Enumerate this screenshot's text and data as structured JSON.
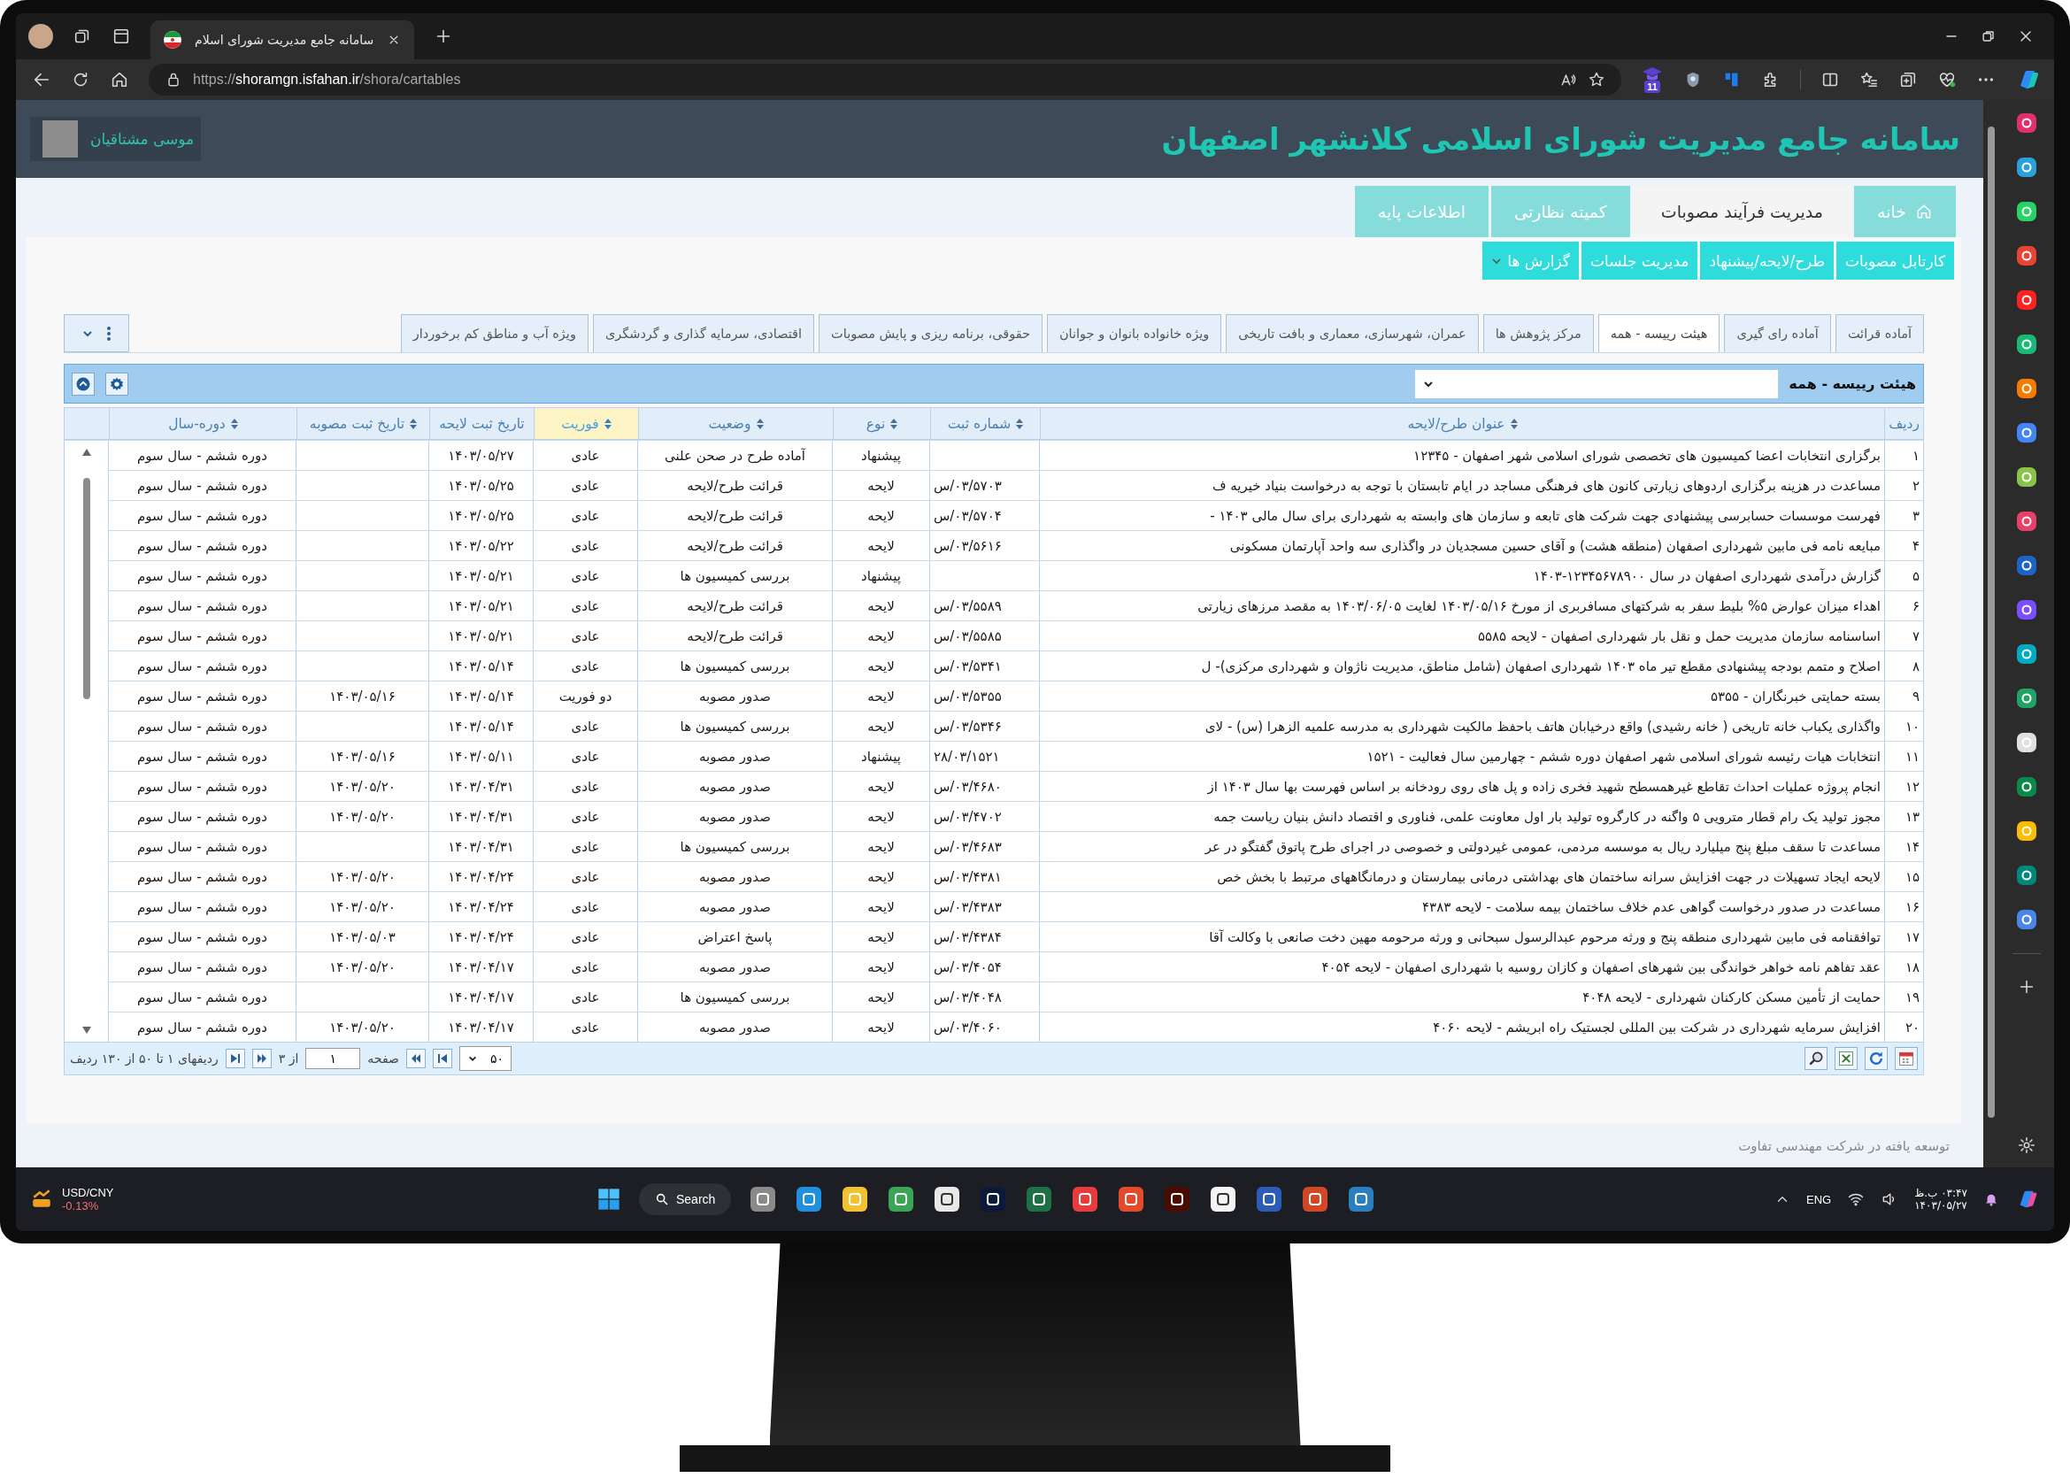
{
  "browser": {
    "tab_title": "سامانه جامع مدیریت شورای اسلام",
    "url": {
      "scheme": "https://",
      "host": "shoramgn.isfahan.ir",
      "path": "/shora/cartables"
    },
    "extension_badge": "11"
  },
  "header": {
    "title": "سامانه جامع مدیریت شورای اسلامی کلانشهر اصفهان",
    "user_name": "موسی مشتاقیان"
  },
  "main_nav": [
    {
      "label": "خانه",
      "kind": "home",
      "selected": false
    },
    {
      "label": "مدیریت فرآیند مصوبات",
      "kind": "plain",
      "selected": true
    },
    {
      "label": "کمیته نظارتی",
      "kind": "plain",
      "selected": false
    },
    {
      "label": "اطلاعات پایه",
      "kind": "plain",
      "selected": false
    }
  ],
  "sub_nav": [
    {
      "label": "کارتابل مصوبات",
      "has_menu": false
    },
    {
      "label": "طرح/لایحه/پیشنهاد",
      "has_menu": false
    },
    {
      "label": "مدیریت جلسات",
      "has_menu": false
    },
    {
      "label": "گزارش ها",
      "has_menu": true
    }
  ],
  "grid": {
    "category_tabs": [
      {
        "label": "آماده قرائت",
        "selected": false
      },
      {
        "label": "آماده رای گیری",
        "selected": false
      },
      {
        "label": "هیئت رییسه - همه",
        "selected": true
      },
      {
        "label": "مرکز پژوهش ها",
        "selected": false
      },
      {
        "label": "عمران، شهرسازی، معماری و بافت تاریخی",
        "selected": false
      },
      {
        "label": "ویژه خانواده بانوان و جوانان",
        "selected": false
      },
      {
        "label": "حقوقی، برنامه ریزی و پایش مصوبات",
        "selected": false
      },
      {
        "label": "اقتصادی، سرمایه گذاری و گردشگری",
        "selected": false
      },
      {
        "label": "ویژه آب و مناطق کم برخوردار",
        "selected": false
      }
    ],
    "filter_label": "هیئت رییسه - همه",
    "columns": [
      {
        "label": "ردیف",
        "sortable": false,
        "sorted": false
      },
      {
        "label": "عنوان طرح/لایحه",
        "sortable": true,
        "sorted": false
      },
      {
        "label": "شماره ثبت",
        "sortable": true,
        "sorted": false
      },
      {
        "label": "نوع",
        "sortable": true,
        "sorted": false
      },
      {
        "label": "وضعیت",
        "sortable": true,
        "sorted": false
      },
      {
        "label": "فوریت",
        "sortable": true,
        "sorted": true
      },
      {
        "label": "تاریخ ثبت لایحه",
        "sortable": false,
        "sorted": false
      },
      {
        "label": "تاریخ ثبت مصوبه",
        "sortable": true,
        "sorted": false
      },
      {
        "label": "دوره-سال",
        "sortable": true,
        "sorted": false
      }
    ],
    "rows": [
      [
        "۱",
        "برگزاری انتخابات اعضا کمیسیون های تخصصی شورای اسلامی شهر اصفهان - ۱۲۳۴۵",
        "",
        "پیشنهاد",
        "آماده طرح در صحن علنی",
        "عادی",
        "۱۴۰۳/۰۵/۲۷",
        "",
        "دوره ششم - سال سوم"
      ],
      [
        "۲",
        "مساعدت در هزینه برگزاری اردوهای زیارتی کانون های فرهنگی مساجد در ایام تابستان با توجه به درخواست بنیاد خیریه ف",
        "س/۰۳/۵۷۰۳",
        "لایحه",
        "قرائت طرح/لایحه",
        "عادی",
        "۱۴۰۳/۰۵/۲۵",
        "",
        "دوره ششم - سال سوم"
      ],
      [
        "۳",
        "فهرست موسسات حسابرسی پیشنهادی جهت شرکت های تابعه و سازمان های وابسته به شهرداری برای سال مالی ۱۴۰۳ -",
        "س/۰۳/۵۷۰۴",
        "لایحه",
        "قرائت طرح/لایحه",
        "عادی",
        "۱۴۰۳/۰۵/۲۵",
        "",
        "دوره ششم - سال سوم"
      ],
      [
        "۴",
        "مبایعه نامه فی مابین شهرداری اصفهان (منطقه هشت) و آقای حسین مسجدیان در واگذاری سه واحد آپارتمان مسکونی",
        "س/۰۳/۵۶۱۶",
        "لایحه",
        "قرائت طرح/لایحه",
        "عادی",
        "۱۴۰۳/۰۵/۲۲",
        "",
        "دوره ششم - سال سوم"
      ],
      [
        "۵",
        "گزارش درآمدی شهرداری اصفهان در سال ۱۲۳۴۵۶۷۸۹۰۰-۱۴۰۳",
        "",
        "پیشنهاد",
        "بررسی کمیسیون ها",
        "عادی",
        "۱۴۰۳/۰۵/۲۱",
        "",
        "دوره ششم - سال سوم"
      ],
      [
        "۶",
        "اهداء میزان عوارض ۵% بلیط سفر به شرکتهای مسافربری از مورخ ۱۴۰۳/۰۵/۱۶ لغایت ۱۴۰۳/۰۶/۰۵ به مقصد مرزهای زیارتی",
        "س/۰۳/۵۵۸۹",
        "لایحه",
        "قرائت طرح/لایحه",
        "عادی",
        "۱۴۰۳/۰۵/۲۱",
        "",
        "دوره ششم - سال سوم"
      ],
      [
        "۷",
        "اساسنامه سازمان مدیریت حمل و نقل بار شهرداری اصفهان - لایحه ۵۵۸۵",
        "س/۰۳/۵۵۸۵",
        "لایحه",
        "قرائت طرح/لایحه",
        "عادی",
        "۱۴۰۳/۰۵/۲۱",
        "",
        "دوره ششم - سال سوم"
      ],
      [
        "۸",
        "اصلاح و متمم بودجه پیشنهادی مقطع تیر ماه ۱۴۰۳ شهرداری اصفهان (شامل مناطق، مدیریت ناژوان و شهرداری مرکزی)- ل",
        "س/۰۳/۵۳۴۱",
        "لایحه",
        "بررسی کمیسیون ها",
        "عادی",
        "۱۴۰۳/۰۵/۱۴",
        "",
        "دوره ششم - سال سوم"
      ],
      [
        "۹",
        "بسته حمایتی خبرنگاران - ۵۳۵۵",
        "س/۰۳/۵۳۵۵",
        "لایحه",
        "صدور مصوبه",
        "دو فوریت",
        "۱۴۰۳/۰۵/۱۴",
        "۱۴۰۳/۰۵/۱۶",
        "دوره ششم - سال سوم"
      ],
      [
        "۱۰",
        "واگذاری یکباب خانه تاریخی ( خانه رشیدی) واقع درخیابان هاتف باحفظ مالکیت شهرداری به مدرسه علمیه الزهرا (س) - لای",
        "س/۰۳/۵۳۴۶",
        "لایحه",
        "بررسی کمیسیون ها",
        "عادی",
        "۱۴۰۳/۰۵/۱۴",
        "",
        "دوره ششم - سال سوم"
      ],
      [
        "۱۱",
        "انتخابات هیات رئیسه شورای اسلامی شهر اصفهان دوره ششم - چهارمین سال فعالیت - ۱۵۲۱",
        "۲۸/۰۳/۱۵۲۱",
        "پیشنهاد",
        "صدور مصوبه",
        "عادی",
        "۱۴۰۳/۰۵/۱۱",
        "۱۴۰۳/۰۵/۱۶",
        "دوره ششم - سال سوم"
      ],
      [
        "۱۲",
        "انجام پروژه عملیات احداث تقاطع غیرهمسطح شهید فخری زاده و پل های روی رودخانه بر اساس فهرست بها سال ۱۴۰۳ از",
        "س/۰۳/۴۶۸۰",
        "لایحه",
        "صدور مصوبه",
        "عادی",
        "۱۴۰۳/۰۴/۳۱",
        "۱۴۰۳/۰۵/۲۰",
        "دوره ششم - سال سوم"
      ],
      [
        "۱۳",
        "مجوز تولید یک رام قطار مترویی ۵ واگنه در کارگروه تولید بار اول معاونت علمی، فناوری و اقتصاد دانش بنیان ریاست جمه",
        "س/۰۳/۴۷۰۲",
        "لایحه",
        "صدور مصوبه",
        "عادی",
        "۱۴۰۳/۰۴/۳۱",
        "۱۴۰۳/۰۵/۲۰",
        "دوره ششم - سال سوم"
      ],
      [
        "۱۴",
        "مساعدت تا سقف مبلغ پنج میلیارد ریال به موسسه مردمی، عمومی غیردولتی و خصوصی در اجرای طرح پاتوق گفتگو در عر",
        "س/۰۳/۴۶۸۳",
        "لایحه",
        "بررسی کمیسیون ها",
        "عادی",
        "۱۴۰۳/۰۴/۳۱",
        "",
        "دوره ششم - سال سوم"
      ],
      [
        "۱۵",
        "لایحه ایجاد تسهیلات در جهت افزایش سرانه ساختمان های بهداشتی درمانی بیمارستان و درمانگاههای مرتبط با بخش خص",
        "س/۰۳/۴۳۸۱",
        "لایحه",
        "صدور مصوبه",
        "عادی",
        "۱۴۰۳/۰۴/۲۴",
        "۱۴۰۳/۰۵/۲۰",
        "دوره ششم - سال سوم"
      ],
      [
        "۱۶",
        "مساعدت در صدور درخواست گواهی عدم خلاف ساختمان بیمه سلامت - لایحه ۴۳۸۳",
        "س/۰۳/۴۳۸۳",
        "لایحه",
        "صدور مصوبه",
        "عادی",
        "۱۴۰۳/۰۴/۲۴",
        "۱۴۰۳/۰۵/۲۰",
        "دوره ششم - سال سوم"
      ],
      [
        "۱۷",
        "توافقنامه فی مابین شهرداری منطقه پنج و ورثه مرحوم عبدالرسول سبحانی و ورثه مرحومه مهین دخت صانعی با وکالت آقا",
        "س/۰۳/۴۳۸۴",
        "لایحه",
        "پاسخ اعتراض",
        "عادی",
        "۱۴۰۳/۰۴/۲۴",
        "۱۴۰۳/۰۵/۰۳",
        "دوره ششم - سال سوم"
      ],
      [
        "۱۸",
        "عقد تفاهم نامه خواهر خواندگی بین شهرهای اصفهان و کازان روسیه با شهرداری اصفهان - لایحه ۴۰۵۴",
        "س/۰۳/۴۰۵۴",
        "لایحه",
        "صدور مصوبه",
        "عادی",
        "۱۴۰۳/۰۴/۱۷",
        "۱۴۰۳/۰۵/۲۰",
        "دوره ششم - سال سوم"
      ],
      [
        "۱۹",
        "حمایت از تأمین مسکن کارکنان شهرداری - لایحه ۴۰۴۸",
        "س/۰۳/۴۰۴۸",
        "لایحه",
        "بررسی کمیسیون ها",
        "عادی",
        "۱۴۰۳/۰۴/۱۷",
        "",
        "دوره ششم - سال سوم"
      ],
      [
        "۲۰",
        "افزایش سرمایه شهرداری در شرکت بین المللی لجستیک راه ابریشم - لایحه ۴۰۶۰",
        "س/۰۳/۴۰۶۰",
        "لایحه",
        "صدور مصوبه",
        "عادی",
        "۱۴۰۳/۰۴/۱۷",
        "۱۴۰۳/۰۵/۲۰",
        "دوره ششم - سال سوم"
      ]
    ],
    "pager": {
      "page_size": "۵۰",
      "page_label": "صفحه",
      "page": "۱",
      "page_count": "از ۳",
      "summary": "ردیفهای ۱ تا ۵۰ از ۱۳۰ ردیف"
    }
  },
  "footer": "توسعه یافته در شرکت مهندسی تفاوت",
  "taskbar": {
    "ticker": "USD/CNY",
    "change": "-0.13%",
    "search": "Search",
    "language": "ENG",
    "time": "۰۳:۴۷ ب.ظ",
    "date": "۱۴۰۳/۰۵/۲۷"
  }
}
